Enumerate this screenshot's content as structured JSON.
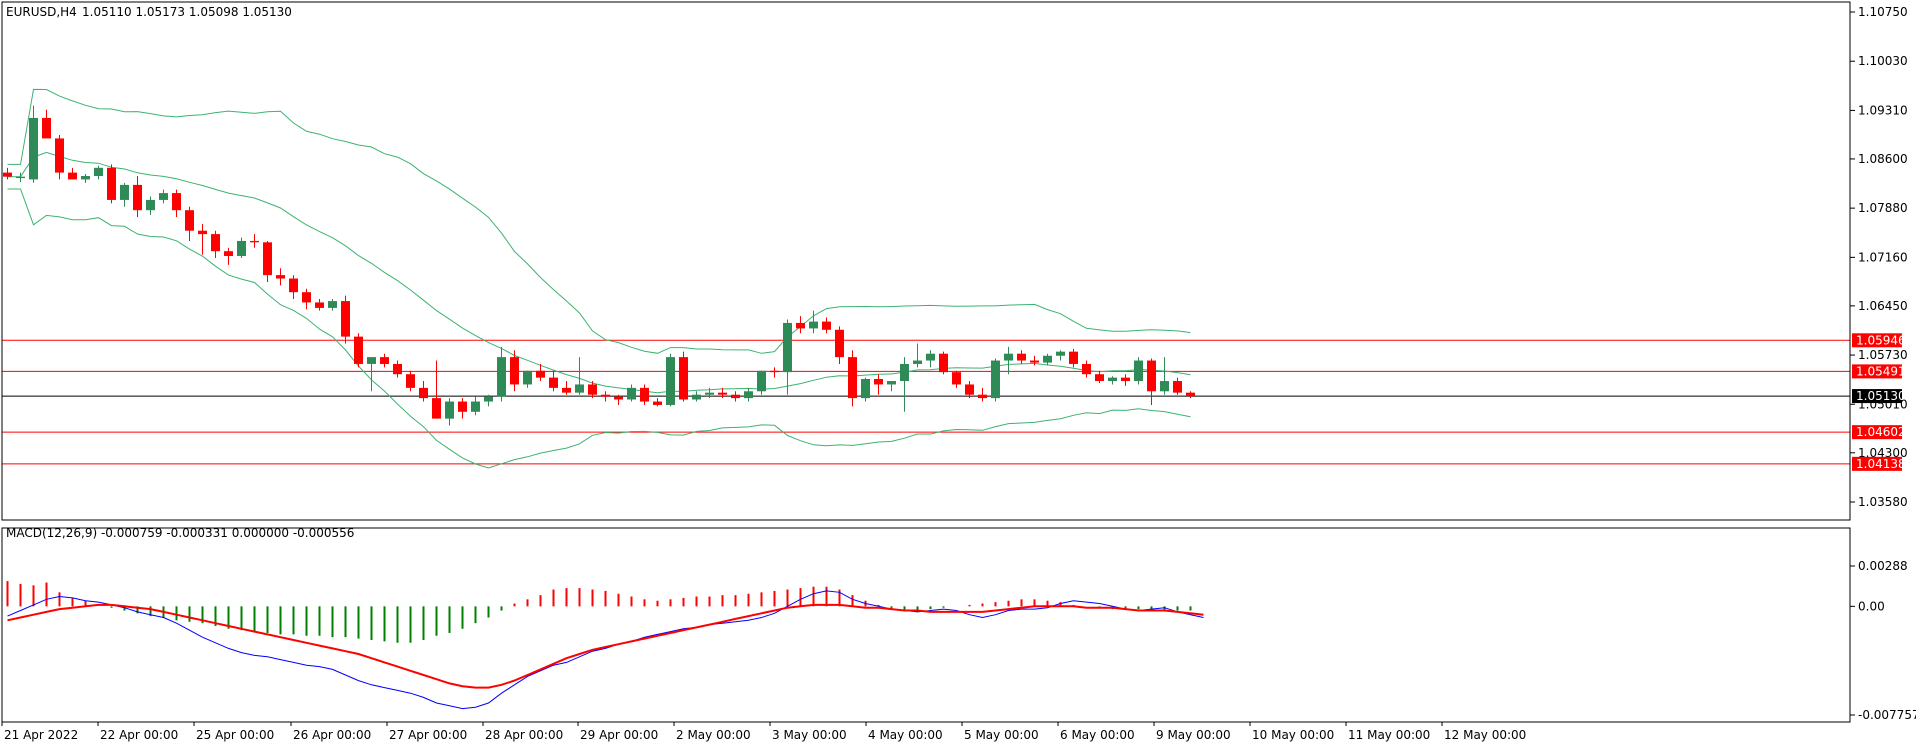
{
  "header": {
    "symbol": "EURUSD,H4",
    "ohlc": "1.05110 1.05173 1.05098 1.05130"
  },
  "macd_header": "MACD(12,26,9) -0.000759 -0.000331 0.000000 -0.000556",
  "colors": {
    "bull": "#2e8b57",
    "bear": "#ff0000",
    "bands": "#3cb371",
    "hline": "#ff0000",
    "price_line": "#000000",
    "macd_line": "#0000ff",
    "signal_line": "#ff0000",
    "hist_pos": "#ff0000",
    "hist_neg": "#008000"
  },
  "chart_data": [
    {
      "type": "candlestick",
      "title": "EURUSD,H4",
      "ylim": [
        1.032,
        1.111
      ],
      "y_ticks": [
        "1.10750",
        "1.10030",
        "1.09310",
        "1.08600",
        "1.07880",
        "1.07160",
        "1.06450",
        "1.05730",
        "1.05010",
        "1.04300",
        "1.03580"
      ],
      "x_ticks": [
        "21 Apr 2022",
        "22 Apr 00:00",
        "25 Apr 00:00",
        "26 Apr 00:00",
        "27 Apr 00:00",
        "28 Apr 00:00",
        "29 Apr 00:00",
        "2 May 00:00",
        "3 May 00:00",
        "4 May 00:00",
        "5 May 00:00",
        "6 May 00:00",
        "9 May 00:00",
        "10 May 00:00",
        "11 May 00:00",
        "12 May 00:00"
      ],
      "current_price": "1.05130",
      "horizontal_levels": [
        "1.05946",
        "1.05491",
        "1.04602",
        "1.04138"
      ],
      "candles": [
        [
          1.084,
          1.0847,
          1.083,
          1.0834
        ],
        [
          1.0832,
          1.084,
          1.0826,
          1.0834
        ],
        [
          1.083,
          1.0938,
          1.0825,
          1.092
        ],
        [
          1.092,
          1.0932,
          1.0895,
          1.089
        ],
        [
          1.089,
          1.0895,
          1.083,
          1.084
        ],
        [
          1.084,
          1.0847,
          1.0832,
          1.083
        ],
        [
          1.083,
          1.0838,
          1.0825,
          1.0835
        ],
        [
          1.0835,
          1.085,
          1.083,
          1.0847
        ],
        [
          1.0847,
          1.0852,
          1.0795,
          1.08
        ],
        [
          1.08,
          1.0825,
          1.079,
          1.0822
        ],
        [
          1.0822,
          1.0835,
          1.0775,
          1.0785
        ],
        [
          1.0785,
          1.0805,
          1.0778,
          1.08
        ],
        [
          1.08,
          1.0815,
          1.0795,
          1.081
        ],
        [
          1.081,
          1.0815,
          1.0775,
          1.0785
        ],
        [
          1.0785,
          1.079,
          1.074,
          1.0755
        ],
        [
          1.0755,
          1.0765,
          1.072,
          1.075
        ],
        [
          1.075,
          1.0755,
          1.0715,
          1.0725
        ],
        [
          1.0725,
          1.073,
          1.0705,
          1.0718
        ],
        [
          1.0718,
          1.0745,
          1.0715,
          1.074
        ],
        [
          1.074,
          1.075,
          1.073,
          1.0738
        ],
        [
          1.0738,
          1.074,
          1.068,
          1.069
        ],
        [
          1.069,
          1.07,
          1.0675,
          1.0685
        ],
        [
          1.0685,
          1.069,
          1.0655,
          1.0665
        ],
        [
          1.0665,
          1.067,
          1.064,
          1.065
        ],
        [
          1.065,
          1.0655,
          1.0638,
          1.0642
        ],
        [
          1.0642,
          1.0655,
          1.0638,
          1.0652
        ],
        [
          1.0652,
          1.066,
          1.059,
          1.06
        ],
        [
          1.06,
          1.0605,
          1.0555,
          1.056
        ],
        [
          1.056,
          1.057,
          1.052,
          1.057
        ],
        [
          1.057,
          1.0575,
          1.0555,
          1.056
        ],
        [
          1.056,
          1.0565,
          1.054,
          1.0545
        ],
        [
          1.0545,
          1.055,
          1.052,
          1.0525
        ],
        [
          1.0525,
          1.0535,
          1.0505,
          1.051
        ],
        [
          1.051,
          1.0565,
          1.048,
          1.048
        ],
        [
          1.048,
          1.051,
          1.047,
          1.0505
        ],
        [
          1.0505,
          1.051,
          1.048,
          1.049
        ],
        [
          1.049,
          1.0512,
          1.0485,
          1.0505
        ],
        [
          1.0505,
          1.0515,
          1.0498,
          1.0512
        ],
        [
          1.0512,
          1.0585,
          1.0505,
          1.057
        ],
        [
          1.057,
          1.058,
          1.052,
          1.053
        ],
        [
          1.053,
          1.055,
          1.0525,
          1.055
        ],
        [
          1.055,
          1.056,
          1.0535,
          1.054
        ],
        [
          1.054,
          1.055,
          1.052,
          1.0525
        ],
        [
          1.0525,
          1.0535,
          1.0515,
          1.0518
        ],
        [
          1.0518,
          1.057,
          1.0515,
          1.053
        ],
        [
          1.053,
          1.0535,
          1.051,
          1.0515
        ],
        [
          1.0515,
          1.052,
          1.0505,
          1.0512
        ],
        [
          1.0512,
          1.0515,
          1.05,
          1.0508
        ],
        [
          1.0508,
          1.053,
          1.0505,
          1.0525
        ],
        [
          1.0525,
          1.053,
          1.05,
          1.0505
        ],
        [
          1.0505,
          1.051,
          1.0498,
          1.05
        ],
        [
          1.05,
          1.0575,
          1.0498,
          1.057
        ],
        [
          1.057,
          1.0578,
          1.0505,
          1.0508
        ],
        [
          1.0508,
          1.052,
          1.0505,
          1.0515
        ],
        [
          1.0515,
          1.0525,
          1.051,
          1.0518
        ],
        [
          1.0518,
          1.0525,
          1.051,
          1.0515
        ],
        [
          1.0515,
          1.052,
          1.0505,
          1.051
        ],
        [
          1.051,
          1.0525,
          1.0505,
          1.052
        ],
        [
          1.052,
          1.055,
          1.0515,
          1.055
        ],
        [
          1.055,
          1.0555,
          1.054,
          1.0548
        ],
        [
          1.0548,
          1.0625,
          1.0515,
          1.062
        ],
        [
          1.062,
          1.063,
          1.0605,
          1.0612
        ],
        [
          1.0612,
          1.0638,
          1.0605,
          1.0622
        ],
        [
          1.0622,
          1.0628,
          1.0605,
          1.061
        ],
        [
          1.061,
          1.0615,
          1.056,
          1.057
        ],
        [
          1.057,
          1.058,
          1.0498,
          1.051
        ],
        [
          1.051,
          1.054,
          1.0505,
          1.0538
        ],
        [
          1.0538,
          1.0545,
          1.0515,
          1.053
        ],
        [
          1.053,
          1.0535,
          1.052,
          1.0535
        ],
        [
          1.0535,
          1.057,
          1.049,
          1.056
        ],
        [
          1.056,
          1.059,
          1.0555,
          1.0565
        ],
        [
          1.0565,
          1.058,
          1.0555,
          1.0575
        ],
        [
          1.0575,
          1.0578,
          1.0545,
          1.0548
        ],
        [
          1.0548,
          1.055,
          1.0525,
          1.053
        ],
        [
          1.053,
          1.0535,
          1.051,
          1.0515
        ],
        [
          1.0515,
          1.0525,
          1.0505,
          1.051
        ],
        [
          1.051,
          1.0568,
          1.0505,
          1.0565
        ],
        [
          1.0565,
          1.0585,
          1.0545,
          1.0575
        ],
        [
          1.0575,
          1.058,
          1.056,
          1.0565
        ],
        [
          1.0565,
          1.0572,
          1.0558,
          1.0562
        ],
        [
          1.0562,
          1.0575,
          1.0558,
          1.0572
        ],
        [
          1.0572,
          1.058,
          1.0565,
          1.0578
        ],
        [
          1.0578,
          1.0582,
          1.0555,
          1.056
        ],
        [
          1.056,
          1.0565,
          1.054,
          1.0545
        ],
        [
          1.0545,
          1.055,
          1.0532,
          1.0535
        ],
        [
          1.0535,
          1.0542,
          1.053,
          1.054
        ],
        [
          1.054,
          1.0545,
          1.0528,
          1.0535
        ],
        [
          1.0535,
          1.057,
          1.053,
          1.0565
        ],
        [
          1.0565,
          1.0568,
          1.05,
          1.052
        ],
        [
          1.052,
          1.057,
          1.0515,
          1.0535
        ],
        [
          1.0535,
          1.054,
          1.0515,
          1.0518
        ],
        [
          1.0518,
          1.052,
          1.051,
          1.0513
        ]
      ]
    },
    {
      "type": "macd",
      "title": "MACD(12,26,9) -0.000759 -0.000331 0.000000 -0.000556",
      "ylim": [
        -0.007757,
        0.00288
      ],
      "y_ticks": [
        "0.00288",
        "0.00",
        "-0.007757"
      ],
      "macd": [
        -0.0007,
        -0.0003,
        0.0001,
        0.0005,
        0.0007,
        0.0006,
        0.0004,
        0.0003,
        0.0001,
        -0.0001,
        -0.0004,
        -0.0006,
        -0.0008,
        -0.0012,
        -0.0017,
        -0.0022,
        -0.0026,
        -0.003,
        -0.0033,
        -0.0035,
        -0.0036,
        -0.0038,
        -0.004,
        -0.0042,
        -0.0043,
        -0.0045,
        -0.0049,
        -0.0053,
        -0.0056,
        -0.0058,
        -0.006,
        -0.0062,
        -0.0065,
        -0.0069,
        -0.0071,
        -0.0073,
        -0.0072,
        -0.0069,
        -0.0062,
        -0.0056,
        -0.005,
        -0.0046,
        -0.0042,
        -0.004,
        -0.0036,
        -0.0032,
        -0.003,
        -0.0027,
        -0.0025,
        -0.0022,
        -0.002,
        -0.0018,
        -0.0016,
        -0.0015,
        -0.0013,
        -0.0012,
        -0.0011,
        -0.001,
        -0.0008,
        -0.0005,
        0.0,
        0.0005,
        0.0009,
        0.0011,
        0.001,
        0.0005,
        0.0002,
        0.0,
        -0.0002,
        -0.0003,
        -0.0004,
        -0.0003,
        -0.0002,
        -0.0003,
        -0.0006,
        -0.0008,
        -0.0006,
        -0.0003,
        -0.0002,
        -0.0002,
        -0.0001,
        0.0002,
        0.0004,
        0.0003,
        0.0002,
        0.0,
        -0.0002,
        -0.0003,
        -0.0002,
        -0.0001,
        -0.0004,
        -0.0006,
        -0.0008
      ],
      "signal": [
        -0.001,
        -0.0008,
        -0.0006,
        -0.0004,
        -0.0002,
        -0.0001,
        0.0,
        0.0001,
        0.0001,
        0.0,
        -0.0001,
        -0.0002,
        -0.0004,
        -0.0006,
        -0.0008,
        -0.001,
        -0.0012,
        -0.0014,
        -0.0016,
        -0.0018,
        -0.002,
        -0.0022,
        -0.0024,
        -0.0026,
        -0.0028,
        -0.003,
        -0.0032,
        -0.0034,
        -0.0037,
        -0.004,
        -0.0043,
        -0.0046,
        -0.0049,
        -0.0052,
        -0.0055,
        -0.0057,
        -0.0058,
        -0.0058,
        -0.0056,
        -0.0053,
        -0.0049,
        -0.0045,
        -0.0041,
        -0.0037,
        -0.0034,
        -0.0031,
        -0.0029,
        -0.0027,
        -0.0025,
        -0.0023,
        -0.0021,
        -0.0019,
        -0.0017,
        -0.0015,
        -0.0013,
        -0.0011,
        -0.0009,
        -0.0007,
        -0.0005,
        -0.0003,
        -0.0001,
        0.0,
        0.0001,
        0.0001,
        0.0001,
        0.0,
        -0.0001,
        -0.0001,
        -0.0002,
        -0.0003,
        -0.0003,
        -0.0004,
        -0.0004,
        -0.0004,
        -0.0004,
        -0.0004,
        -0.0003,
        -0.0002,
        -0.0001,
        0.0,
        0.0,
        0.0,
        0.0,
        -0.0001,
        -0.0001,
        -0.0001,
        -0.0002,
        -0.0003,
        -0.0003,
        -0.0003,
        -0.0004,
        -0.0005,
        -0.0006
      ],
      "histogram": [
        0.0018,
        0.0016,
        0.0015,
        0.0017,
        0.001,
        0.0006,
        0.0004,
        0.0,
        -0.0001,
        -0.0003,
        -0.0005,
        -0.0007,
        -0.0008,
        -0.001,
        -0.0011,
        -0.0012,
        -0.0014,
        -0.0016,
        -0.0017,
        -0.0018,
        -0.0019,
        -0.002,
        -0.002,
        -0.0021,
        -0.0021,
        -0.0022,
        -0.0022,
        -0.0023,
        -0.0024,
        -0.0025,
        -0.0026,
        -0.0026,
        -0.0024,
        -0.0021,
        -0.0019,
        -0.0016,
        -0.0012,
        -0.0008,
        -0.0003,
        0.0002,
        0.0005,
        0.0008,
        0.0012,
        0.0013,
        0.0013,
        0.0012,
        0.0011,
        0.0009,
        0.0007,
        0.0005,
        0.0004,
        0.0005,
        0.0006,
        0.0007,
        0.0007,
        0.0008,
        0.0008,
        0.0009,
        0.001,
        0.0011,
        0.0012,
        0.0013,
        0.0014,
        0.0014,
        0.0012,
        0.0008,
        0.0004,
        0.0001,
        -0.0002,
        -0.0003,
        -0.0003,
        -0.0002,
        -0.0001,
        0.0,
        0.0001,
        0.0002,
        0.0003,
        0.0004,
        0.0005,
        0.0005,
        0.0004,
        0.0003,
        0.0001,
        0.0,
        -0.0001,
        -0.0002,
        -0.0002,
        -0.0002,
        -0.0003,
        -0.0003,
        -0.0003,
        -0.0003
      ]
    }
  ]
}
